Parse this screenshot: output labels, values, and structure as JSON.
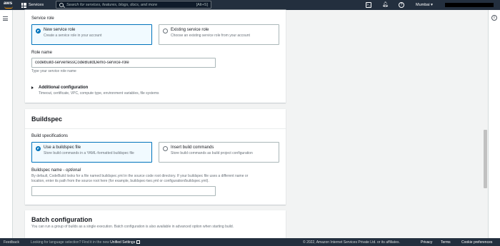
{
  "topnav": {
    "logo_text": "aws",
    "services_label": "Services",
    "search_placeholder": "Search for services, features, blogs, docs, and more",
    "search_shortcut": "[Alt+S]",
    "region_label": "Mumbai ▾"
  },
  "service_role_section": {
    "label": "Service role",
    "options": [
      {
        "title": "New service role",
        "description": "Create a service role in your account",
        "selected": true
      },
      {
        "title": "Existing service role",
        "description": "Choose an existing service role from your account",
        "selected": false
      }
    ],
    "role_name_label": "Role name",
    "role_name_value": "codebuild-serverlessCodeBuildDemo-service-role",
    "role_name_hint": "Type your service role name",
    "additional_config_title": "Additional configuration",
    "additional_config_desc": "Timeout, certificate, VPC, compute type, environment variables, file systems"
  },
  "buildspec_section": {
    "title": "Buildspec",
    "label": "Build specifications",
    "options": [
      {
        "title": "Use a buildspec file",
        "description": "Store build commands in a YAML-formatted buildspec file",
        "selected": true
      },
      {
        "title": "Insert build commands",
        "description": "Store build commands as build project configuration",
        "selected": false
      }
    ],
    "buildspec_name_label": "Buildspec name - ",
    "buildspec_name_optional": "optional",
    "buildspec_name_desc_line1": "By default, CodeBuild looks for a file named buildspec.yml in the source code root directory. If your buildspec file uses a different name or",
    "buildspec_name_desc_line2": "location, enter its path from the source root here (for example, buildspec-two.yml or configuration/buildspec.yml).",
    "buildspec_name_value": ""
  },
  "batch_section": {
    "title": "Batch configuration",
    "description": "You can run a group of builds as a single execution. Batch configuration is also available in advanced option when starting build."
  },
  "footer": {
    "feedback": "Feedback",
    "language_text": "Looking for language selection? Find it in the new ",
    "unified_settings": "Unified Settings",
    "copyright": "© 2022, Amazon Internet Services Private Ltd. or its affiliates.",
    "privacy": "Privacy",
    "terms": "Terms",
    "cookie": "Cookie preferences"
  },
  "colors": {
    "nav_bg": "#232f3e",
    "accent": "#0073bb",
    "aws_orange": "#ff9900"
  }
}
